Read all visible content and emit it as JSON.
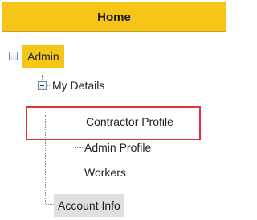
{
  "header": {
    "title": "Home"
  },
  "tree": {
    "admin": {
      "label": "Admin",
      "expander_icon": "minus-expander-icon"
    },
    "my_details": {
      "label": "My Details",
      "expander_icon": "minus-expander-icon"
    },
    "contractor_profile": {
      "label": "Contractor Profile"
    },
    "admin_profile": {
      "label": "Admin Profile"
    },
    "workers": {
      "label": "Workers"
    },
    "account_info": {
      "label": "Account Info"
    }
  },
  "colors": {
    "header_bg": "#f5c518",
    "admin_highlight": "#f5c518",
    "selected_node_bg": "#e0e0e0",
    "focus_outline": "#e2323a"
  }
}
